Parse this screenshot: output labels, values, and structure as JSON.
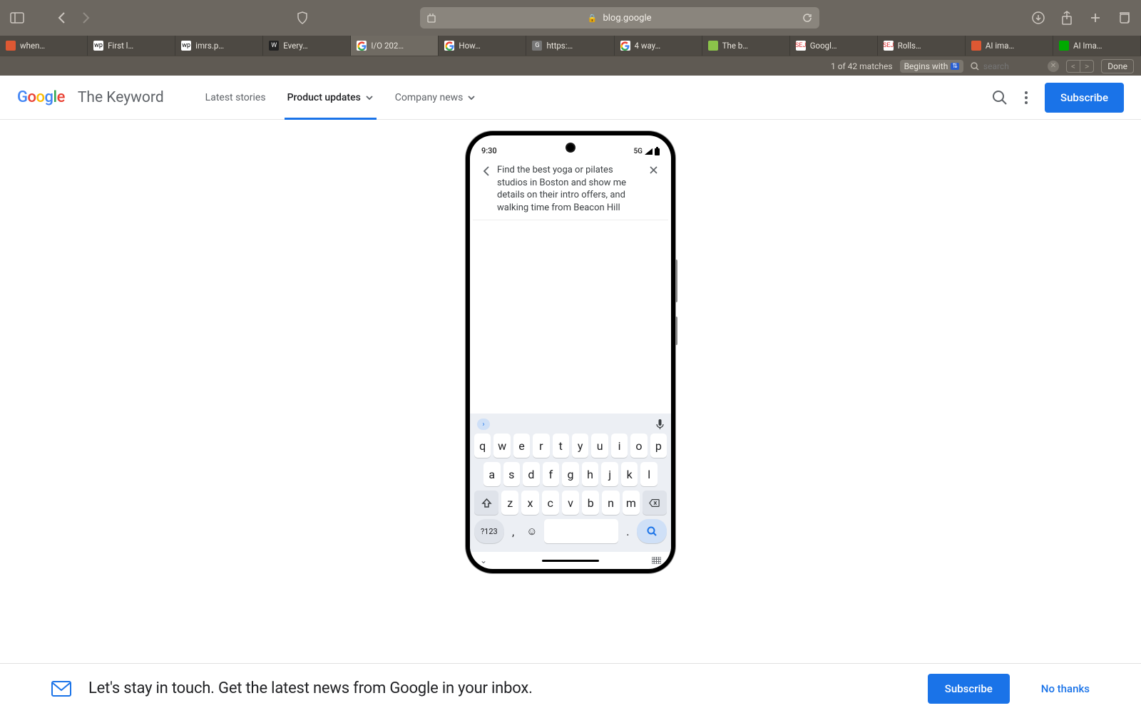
{
  "browser": {
    "url": "blog.google",
    "tabs": [
      {
        "label": "when…",
        "favicon_bg": "#de5833",
        "favicon_text": ""
      },
      {
        "label": "First l…",
        "favicon_bg": "#fff",
        "favicon_text": "wp",
        "favicon_fg": "#000"
      },
      {
        "label": "imrs.p…",
        "favicon_bg": "#fff",
        "favicon_text": "wp",
        "favicon_fg": "#000"
      },
      {
        "label": "Every…",
        "favicon_bg": "#222",
        "favicon_text": "W"
      },
      {
        "label": "I/O 202…",
        "favicon_bg": "#fff",
        "favicon_text": "G",
        "active": true
      },
      {
        "label": "How…",
        "favicon_bg": "#fff",
        "favicon_text": "G"
      },
      {
        "label": "https:…",
        "favicon_bg": "#777",
        "favicon_text": "G"
      },
      {
        "label": "4 way…",
        "favicon_bg": "#fff",
        "favicon_text": "G"
      },
      {
        "label": "The b…",
        "favicon_bg": "#8bc34a",
        "favicon_text": ""
      },
      {
        "label": "Googl…",
        "favicon_bg": "#fff",
        "favicon_text": "SEJ",
        "favicon_fg": "#d33"
      },
      {
        "label": "Rolls…",
        "favicon_bg": "#fff",
        "favicon_text": "SEJ",
        "favicon_fg": "#d33"
      },
      {
        "label": "AI ima…",
        "favicon_bg": "#de5833",
        "favicon_text": ""
      },
      {
        "label": "AI Ima…",
        "favicon_bg": "#0a0",
        "favicon_text": ""
      }
    ],
    "find": {
      "matches": "1 of 42 matches",
      "mode": "Begins with",
      "placeholder": "search",
      "done": "Done"
    }
  },
  "site": {
    "title": "The Keyword",
    "nav": {
      "latest": "Latest stories",
      "product": "Product updates",
      "company": "Company news"
    },
    "subscribe": "Subscribe"
  },
  "phone": {
    "time": "9:30",
    "network": "5G",
    "query": "Find the best yoga or pilates studios in Boston and show me details on their intro offers, and walking time from Beacon Hill",
    "keyboard": {
      "row1": [
        "q",
        "w",
        "e",
        "r",
        "t",
        "y",
        "u",
        "i",
        "o",
        "p"
      ],
      "row2": [
        "a",
        "s",
        "d",
        "f",
        "g",
        "h",
        "j",
        "k",
        "l"
      ],
      "row3": [
        "z",
        "x",
        "c",
        "v",
        "b",
        "n",
        "m"
      ],
      "numlabel": "?123",
      "comma": ",",
      "dot": "."
    }
  },
  "newsletter": {
    "message": "Let's stay in touch. Get the latest news from Google in your inbox.",
    "subscribe": "Subscribe",
    "no_thanks": "No thanks"
  }
}
